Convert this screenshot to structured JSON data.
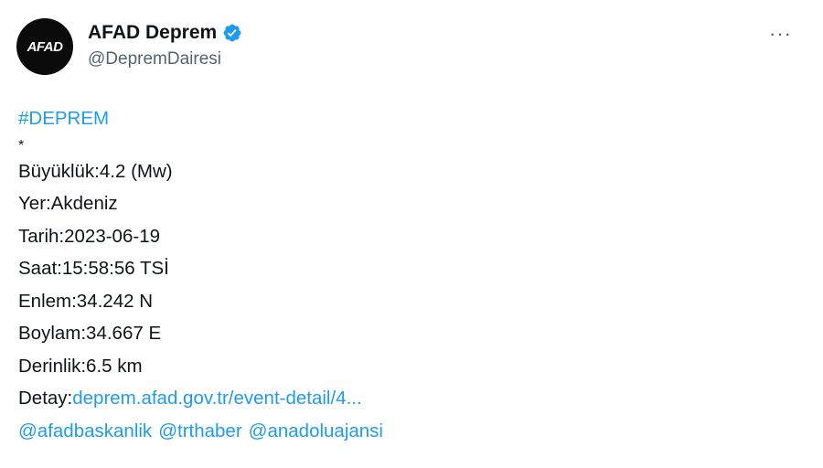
{
  "account": {
    "avatar_text": "AFAD",
    "display_name": "AFAD Deprem",
    "handle": "@DepremDairesi",
    "verified": true,
    "verified_color": "#1d9bf0",
    "avatar_color": "#0b0b0b"
  },
  "menu": {
    "more_label": "···"
  },
  "tweet": {
    "hashtag": "#DEPREM",
    "separator": "*",
    "magnitude": "Büyüklük:4.2 (Mw)",
    "location": "Yer:Akdeniz",
    "date": "Tarih:2023-06-19",
    "time": "Saat:15:58:56 TSİ",
    "latitude": "Enlem:34.242 N",
    "longitude": "Boylam:34.667 E",
    "depth": "Derinlik:6.5 km",
    "detail_label": "Detay:",
    "detail_link": "deprem.afad.gov.tr/event-detail/4...",
    "mentions": [
      "@afadbaskanlik",
      "@trthaber",
      "@anadoluajansi"
    ]
  },
  "colors": {
    "link": "#1d9bf0",
    "text": "#0f1419",
    "secondary": "#536471"
  }
}
